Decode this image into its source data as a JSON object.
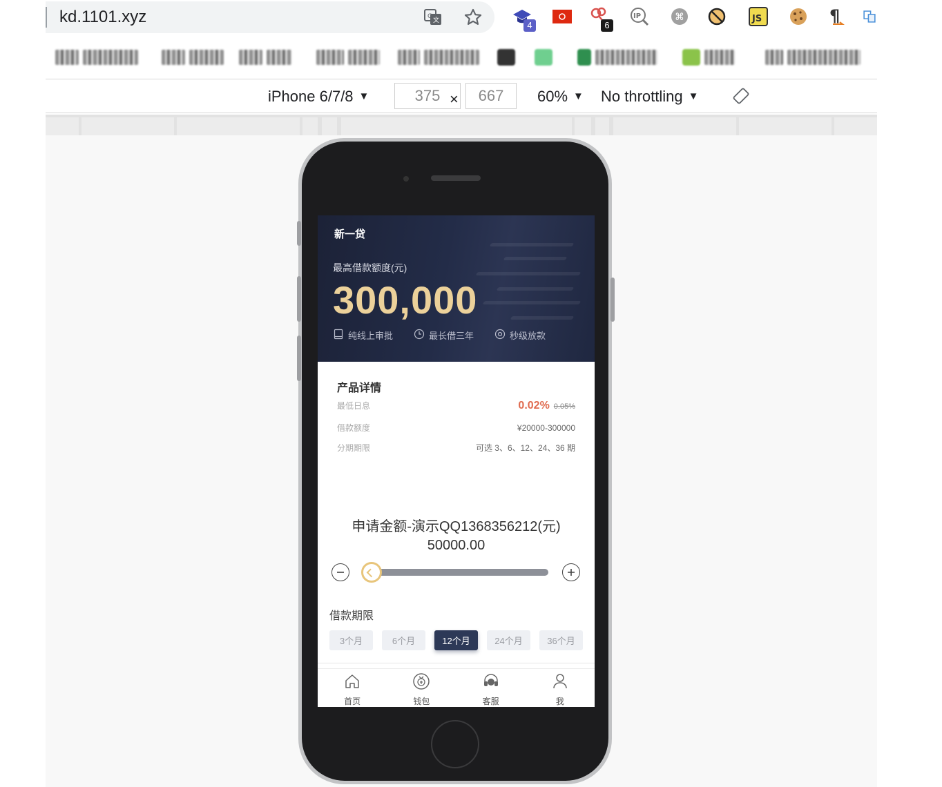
{
  "browser": {
    "url": "kd.1101.xyz",
    "extensions": [
      {
        "icon": "grad-cap-icon",
        "badge": "4"
      },
      {
        "icon": "hk-flag-icon",
        "badge": ""
      },
      {
        "icon": "key-icon",
        "badge": "6"
      },
      {
        "icon": "ip-lookup-icon",
        "badge": ""
      },
      {
        "icon": "command-icon",
        "badge": ""
      },
      {
        "icon": "block-icon",
        "badge": ""
      },
      {
        "icon": "js-icon",
        "badge": ""
      },
      {
        "icon": "cookie-icon",
        "badge": ""
      },
      {
        "icon": "pilcrow-icon",
        "badge": ""
      },
      {
        "icon": "translate-icon",
        "badge": ""
      }
    ]
  },
  "devtools": {
    "device": "iPhone 6/7/8",
    "width": "375",
    "times": "×",
    "height": "667",
    "zoom": "60%",
    "throttling": "No throttling"
  },
  "app": {
    "brand": "新一贷",
    "limit_label": "最高借款额度(元)",
    "limit_value": "300,000",
    "features": [
      {
        "icon": "book-icon",
        "label": "纯线上审批"
      },
      {
        "icon": "clock-icon",
        "label": "最长借三年"
      },
      {
        "icon": "target-icon",
        "label": "秒级放款"
      }
    ],
    "details": {
      "title": "产品详情",
      "rate_label": "最低日息",
      "rate": "0.02%",
      "rate_old": "0.05%",
      "amount_label": "借款额度",
      "amount_range": "¥20000-300000",
      "period_label": "分期期限",
      "period_options": "可选 3、6、12、24、36 期"
    },
    "apply": {
      "title": "申请金额-演示QQ1368356212(元)",
      "amount": "50000.00",
      "slider_fraction": 0.04
    },
    "term": {
      "label": "借款期限",
      "options": [
        "3个月",
        "6个月",
        "12个月",
        "24个月",
        "36个月"
      ],
      "selected": "12个月"
    },
    "tabs": [
      {
        "icon": "home-icon",
        "label": "首页"
      },
      {
        "icon": "wallet-icon",
        "label": "钱包"
      },
      {
        "icon": "headset-icon",
        "label": "客服"
      },
      {
        "icon": "user-icon",
        "label": "我"
      }
    ],
    "colors": {
      "accent_gold": "#ecd19a",
      "rate_red": "#e06b4f",
      "active_term": "#2d3957"
    }
  }
}
